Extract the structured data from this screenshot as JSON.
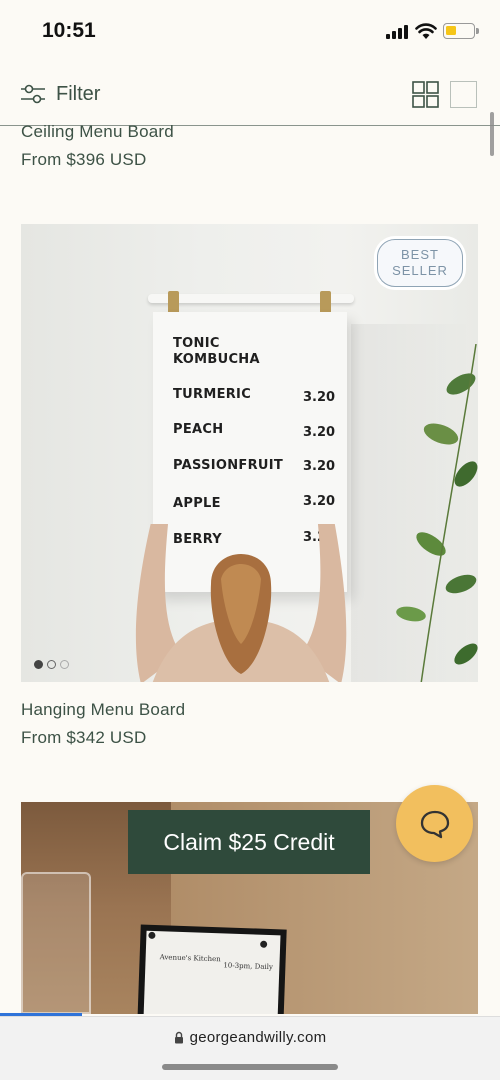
{
  "status_bar": {
    "time": "10:51"
  },
  "filter_bar": {
    "filter_label": "Filter"
  },
  "products": [
    {
      "title": "Ceiling Menu Board",
      "price": "From $396 USD"
    },
    {
      "title": "Hanging Menu Board",
      "price": "From $342 USD",
      "badge_line1": "BEST",
      "badge_line2": "SELLER",
      "menu": {
        "heading1": "TONIC",
        "heading2": "KOMBUCHA",
        "items": [
          {
            "name": "TURMERIC",
            "price": "3.20"
          },
          {
            "name": "PEACH",
            "price": "3.20"
          },
          {
            "name": "PASSIONFRUIT",
            "price": "3.20"
          },
          {
            "name": "APPLE",
            "price": "3.20"
          },
          {
            "name": "BERRY",
            "price": "3.20"
          }
        ]
      },
      "carousel_active_index": 0,
      "carousel_count": 3
    },
    {
      "frame_text1": "Avenue's Kitchen",
      "frame_text2": "10-3pm, Daily"
    }
  ],
  "promo": {
    "claim_label": "Claim $25 Credit"
  },
  "browser": {
    "url": "georgeandwilly.com"
  },
  "colors": {
    "accent_green": "#2f4a3b",
    "chat_yellow": "#f2bf5e",
    "badge_blue": "#7d93a6"
  },
  "icons": [
    "signal-icon",
    "wifi-icon",
    "battery-icon",
    "filter-icon",
    "grid-view-icon",
    "single-view-icon",
    "chat-icon",
    "lock-icon"
  ]
}
